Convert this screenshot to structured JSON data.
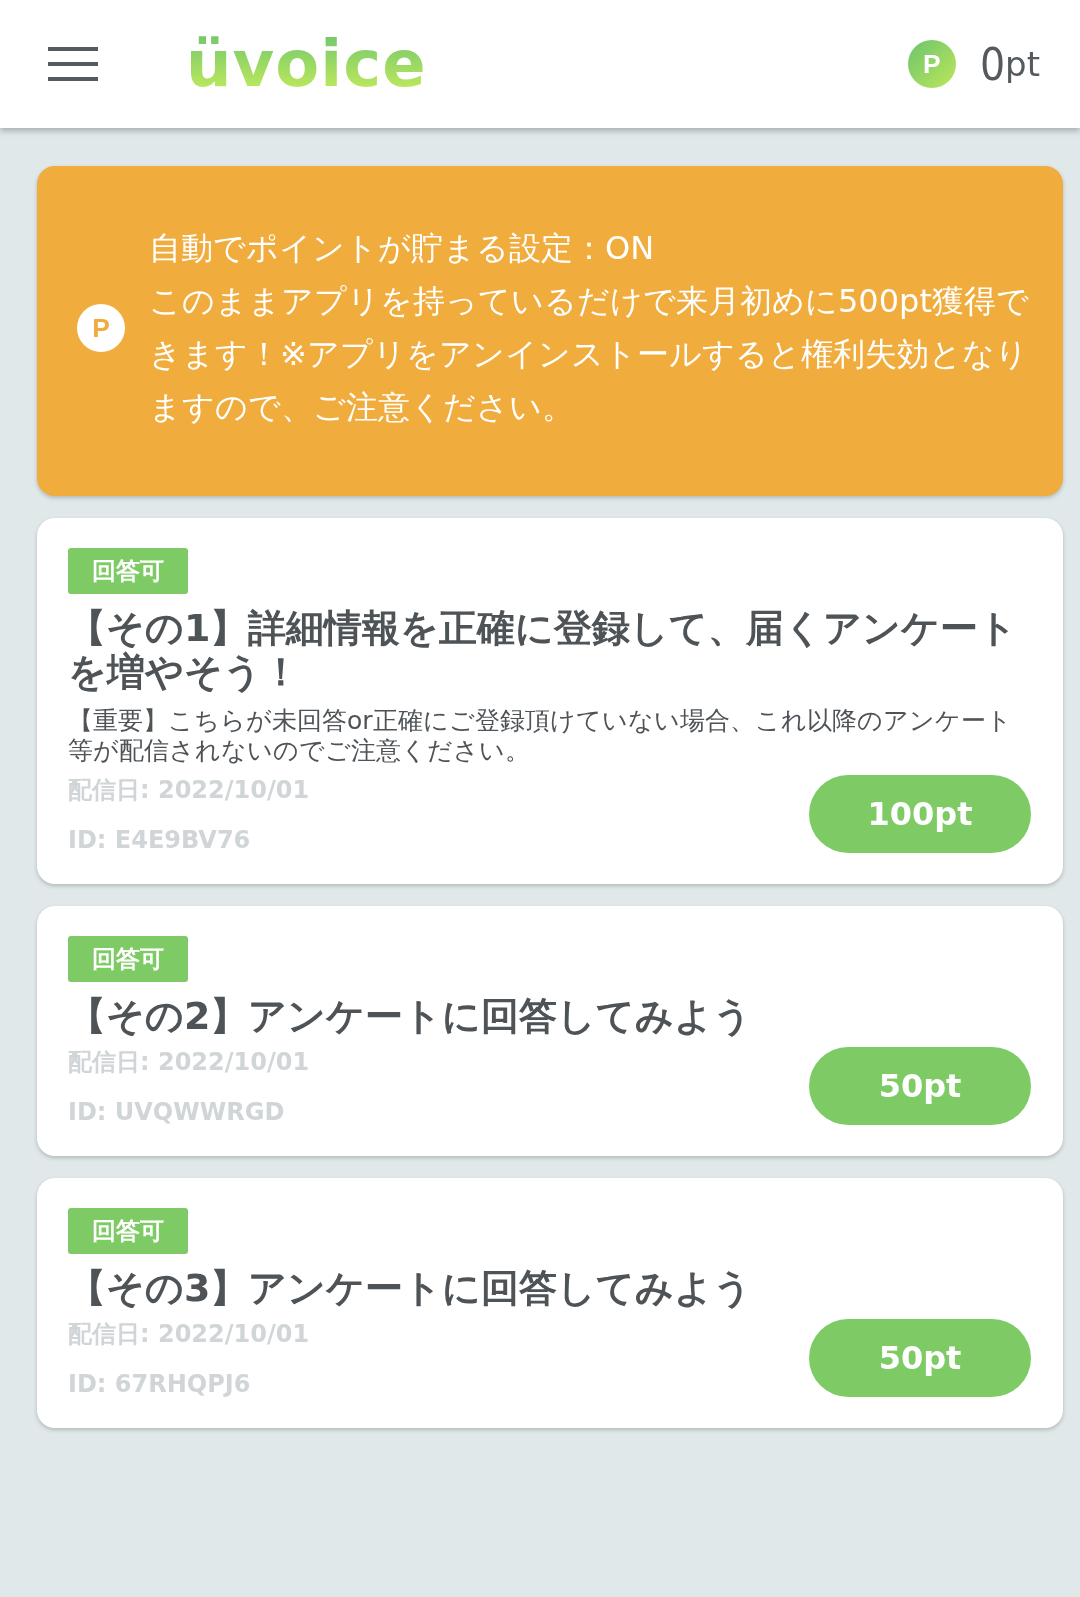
{
  "header": {
    "logo": "üvoice",
    "points": {
      "badge": "P",
      "value": "0",
      "unit": "pt"
    }
  },
  "banner": {
    "badge": "P",
    "lines": [
      "自動でポイントが貯まる設定：ON",
      "このままアプリを持っているだけで来月初めに500pt獲得できます！※アプリをアンインストールすると権利失効となりますので、ご注意ください。"
    ]
  },
  "surveys": [
    {
      "status": "回答可",
      "title": "【その1】詳細情報を正確に登録して、届くアンケートを増やそう！",
      "description": "【重要】こちらが未回答or正確にご登録頂けていない場合、これ以降のアンケート等が配信されないのでご注意ください。",
      "date": "配信日: 2022/10/01",
      "id": "ID: E4E9BV76",
      "reward": "100pt"
    },
    {
      "status": "回答可",
      "title": "【その2】アンケートに回答してみよう",
      "date": "配信日: 2022/10/01",
      "id": "ID: UVQWWRGD",
      "reward": "50pt"
    },
    {
      "status": "回答可",
      "title": "【その3】アンケートに回答してみよう",
      "date": "配信日: 2022/10/01",
      "id": "ID: 67RHQPJ6",
      "reward": "50pt"
    }
  ]
}
